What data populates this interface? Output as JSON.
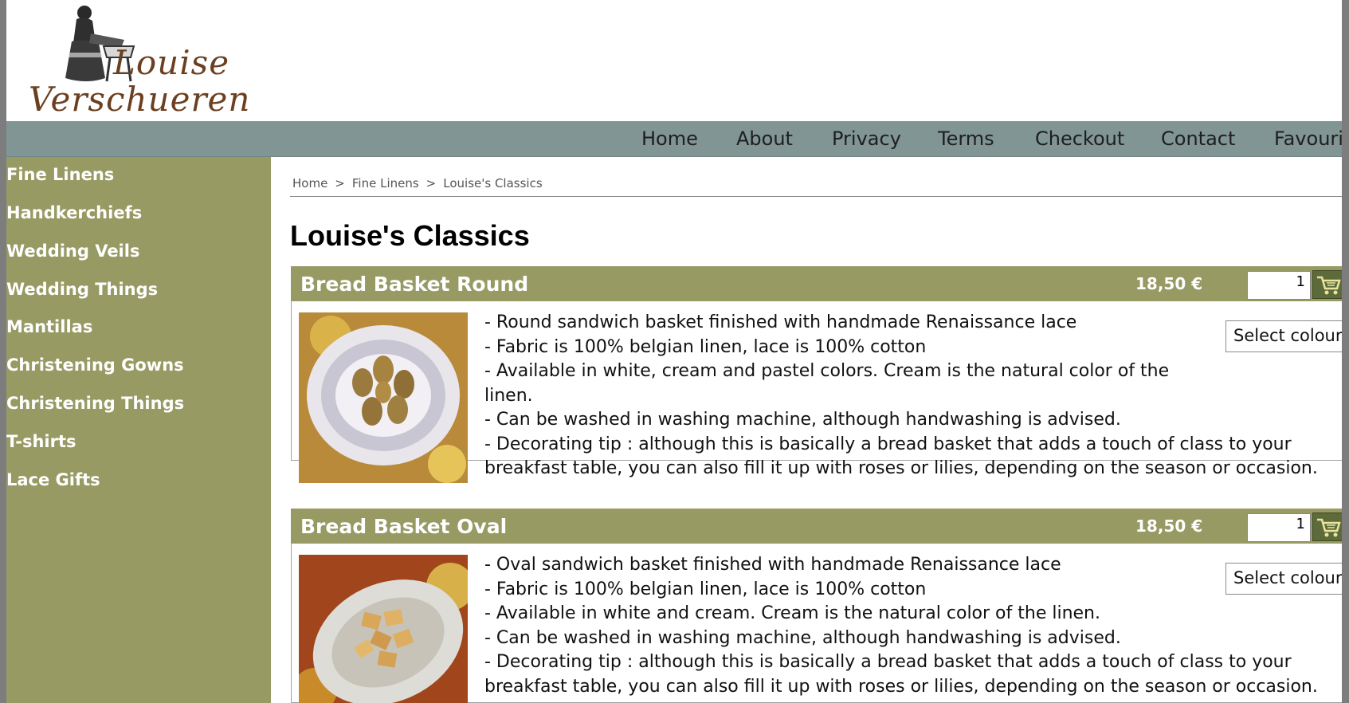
{
  "brand": {
    "line1": "Louise",
    "line2": "Verschueren"
  },
  "nav": [
    "Home",
    "About",
    "Privacy",
    "Terms",
    "Checkout",
    "Contact",
    "Favourites"
  ],
  "sidebar": [
    "Fine Linens",
    "Handkerchiefs",
    "Wedding Veils",
    "Wedding Things",
    "Mantillas",
    "Christening Gowns",
    "Christening Things",
    "T-shirts",
    "Lace Gifts"
  ],
  "breadcrumb": [
    "Home",
    "Fine Linens",
    "Louise's Classics"
  ],
  "breadcrumb_sep": ">",
  "page_title": "Louise's Classics",
  "products": [
    {
      "name": "Bread Basket Round",
      "price": "18,50 €",
      "qty": "1",
      "select_label": "Select colour",
      "lines": [
        "- Round sandwich basket finished with handmade Renaissance lace",
        "- Fabric is 100% belgian linen, lace is 100% cotton",
        "- Available in white, cream and pastel colors. Cream is the natural color of the",
        "linen.",
        "- Can be washed in washing machine, although handwashing is advised.",
        "- Decorating tip : although this is basically a bread basket that adds a touch of class to your",
        "breakfast table, you can also fill it up with roses or lilies, depending on the season or occasion."
      ]
    },
    {
      "name": "Bread Basket Oval",
      "price": "18,50 €",
      "qty": "1",
      "select_label": "Select colour",
      "lines": [
        "- Oval sandwich basket finished with handmade Renaissance lace",
        "- Fabric is 100% belgian linen, lace is 100% cotton",
        "- Available in white and cream. Cream is the natural color of the linen.",
        "- Can be washed in washing machine, although handwashing is advised.",
        "- Decorating tip : although this is basically a bread basket that adds a touch of class to your",
        "breakfast table, you can also fill it up with roses or lilies, depending on the season or occasion."
      ]
    }
  ],
  "colors": {
    "sidebar": "#989a64",
    "navbar": "#809594",
    "product_header": "#989a64"
  }
}
